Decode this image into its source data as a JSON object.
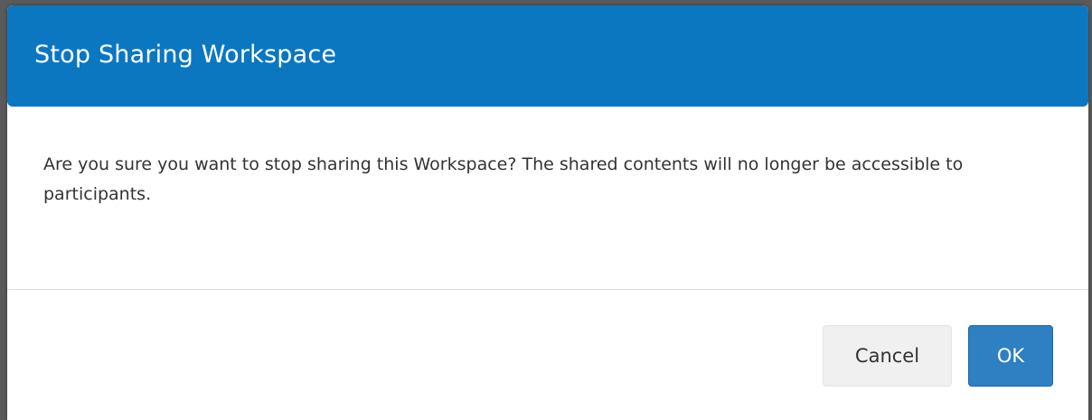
{
  "dialog": {
    "title": "Stop Sharing Workspace",
    "message": "Are you sure you want to stop sharing this Workspace? The shared contents will no longer be accessible to participants.",
    "buttons": {
      "cancel_label": "Cancel",
      "ok_label": "OK"
    }
  },
  "colors": {
    "header_background": "#0b77c1",
    "ok_button_background": "#2f7fc3",
    "cancel_button_background": "#f0f0f0"
  }
}
